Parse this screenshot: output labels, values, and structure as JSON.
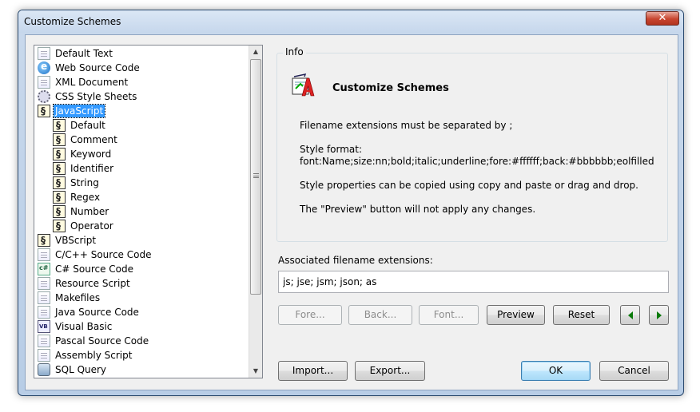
{
  "window": {
    "title": "Customize Schemes",
    "close_glyph": "✕"
  },
  "tree": {
    "items": [
      {
        "label": "Default Text",
        "icon": "document-icon",
        "level": 0
      },
      {
        "label": "Web Source Code",
        "icon": "web-icon",
        "level": 0
      },
      {
        "label": "XML Document",
        "icon": "document-icon",
        "level": 0
      },
      {
        "label": "CSS Style Sheets",
        "icon": "gear-icon",
        "level": 0
      },
      {
        "label": "JavaScript",
        "icon": "script-icon",
        "level": 0,
        "selected": true
      },
      {
        "label": "Default",
        "icon": "script-icon",
        "level": 1
      },
      {
        "label": "Comment",
        "icon": "script-icon",
        "level": 1
      },
      {
        "label": "Keyword",
        "icon": "script-icon",
        "level": 1
      },
      {
        "label": "Identifier",
        "icon": "script-icon",
        "level": 1
      },
      {
        "label": "String",
        "icon": "script-icon",
        "level": 1
      },
      {
        "label": "Regex",
        "icon": "script-icon",
        "level": 1
      },
      {
        "label": "Number",
        "icon": "script-icon",
        "level": 1
      },
      {
        "label": "Operator",
        "icon": "script-icon",
        "level": 1
      },
      {
        "label": "VBScript",
        "icon": "script-icon",
        "level": 0
      },
      {
        "label": "C/C++ Source Code",
        "icon": "document-icon",
        "level": 0
      },
      {
        "label": "C# Source Code",
        "icon": "csharp-icon",
        "level": 0
      },
      {
        "label": "Resource Script",
        "icon": "document-icon",
        "level": 0
      },
      {
        "label": "Makefiles",
        "icon": "document-icon",
        "level": 0
      },
      {
        "label": "Java Source Code",
        "icon": "document-icon",
        "level": 0
      },
      {
        "label": "Visual Basic",
        "icon": "vb-icon",
        "level": 0
      },
      {
        "label": "Pascal Source Code",
        "icon": "document-icon",
        "level": 0
      },
      {
        "label": "Assembly Script",
        "icon": "document-icon",
        "level": 0
      },
      {
        "label": "SQL Query",
        "icon": "database-icon",
        "level": 0
      }
    ]
  },
  "info": {
    "legend": "Info",
    "title": "Customize Schemes",
    "lines": [
      "Filename extensions must be separated by ;",
      "Style format:",
      "font:Name;size:nn;bold;italic;underline;fore:#ffffff;back:#bbbbbb;eolfilled",
      "Style properties can be copied using copy and paste or drag and drop.",
      "The \"Preview\" button will not apply any changes."
    ]
  },
  "extensions": {
    "label": "Associated filename extensions:",
    "value": "js; jse; jsm; json; as"
  },
  "buttons": {
    "fore": "Fore...",
    "back": "Back...",
    "font": "Font...",
    "preview": "Preview",
    "reset": "Reset",
    "import": "Import...",
    "export": "Export...",
    "ok": "OK",
    "cancel": "Cancel"
  },
  "colors": {
    "selection": "#3399ff",
    "nav_arrow": "#0a7a0a"
  }
}
